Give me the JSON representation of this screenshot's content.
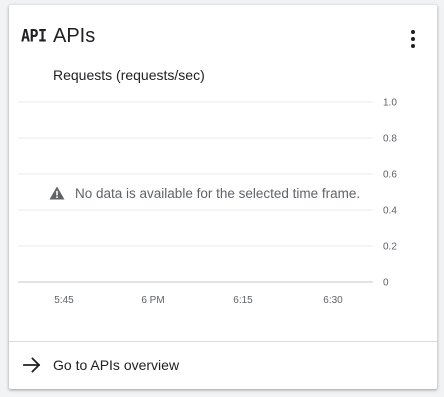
{
  "card": {
    "icon_text": "API",
    "title": "APIs",
    "menu_icon": "more-vert-icon"
  },
  "chart": {
    "title": "Requests (requests/sec)",
    "no_data_message": "No data is available for the selected time frame.",
    "warning_icon": "warning-icon"
  },
  "chart_data": {
    "type": "line",
    "title": "Requests (requests/sec)",
    "xlabel": "",
    "ylabel": "",
    "x_ticks": [
      "5:45",
      "6 PM",
      "6:15",
      "6:30"
    ],
    "y_ticks": [
      "1.0",
      "0.8",
      "0.6",
      "0.4",
      "0.2",
      "0"
    ],
    "ylim": [
      0,
      1.0
    ],
    "grid": true,
    "series": []
  },
  "footer": {
    "link_label": "Go to APIs overview",
    "icon": "arrow-forward-icon"
  },
  "colors": {
    "text_primary": "#202124",
    "text_secondary": "#5f6368",
    "gridline": "#e8eaed",
    "divider": "#dadce0"
  }
}
